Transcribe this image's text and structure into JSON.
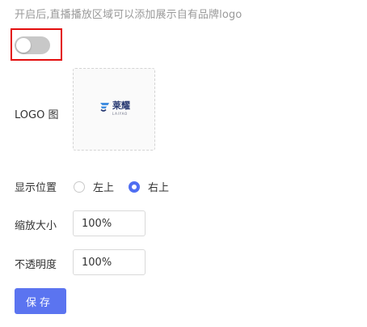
{
  "hint": "开启后,直播播放区域可以添加展示自有品牌logo",
  "logo_switch": {
    "enabled": false
  },
  "logo": {
    "label": "LOGO 图",
    "brand_text": "莱耀",
    "brand_sub": "LAIYAO"
  },
  "position": {
    "label": "显示位置",
    "options": [
      "左上",
      "右上"
    ],
    "selected": "右上"
  },
  "scale": {
    "label": "缩放大小",
    "value": "100%"
  },
  "opacity": {
    "label": "不透明度",
    "value": "100%"
  },
  "save_label": "保存",
  "colors": {
    "accent": "#5b74f0",
    "highlight": "#e30d0d",
    "switch_off": "#c8c8c8"
  }
}
